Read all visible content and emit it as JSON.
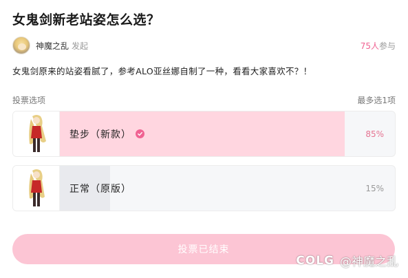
{
  "post": {
    "title": "女鬼剑新老站姿怎么选？",
    "author": {
      "name": "神魔之乱",
      "action": "发起"
    },
    "participants": {
      "count": "75人",
      "suffix": "参与"
    },
    "description": "女鬼剑原来的站姿看腻了，参考ALO亚丝娜自制了一种，看看大家喜欢不？！"
  },
  "poll": {
    "header_label": "投票选项",
    "max_choice": "最多选1项",
    "options": [
      {
        "label": "垫步（新款）",
        "percent": "85%",
        "ratio": 0.85,
        "selected": true
      },
      {
        "label": "正常（原版）",
        "percent": "15%",
        "ratio": 0.15,
        "selected": false
      }
    ],
    "button_label": "投票已结束"
  },
  "watermark": {
    "logo": "COLG",
    "text": "@神魔之乱"
  },
  "colors": {
    "accent": "#f06292",
    "fill_selected": "#ffd6e0",
    "fill_other": "#e9eaee",
    "button": "#fcc5d4"
  }
}
